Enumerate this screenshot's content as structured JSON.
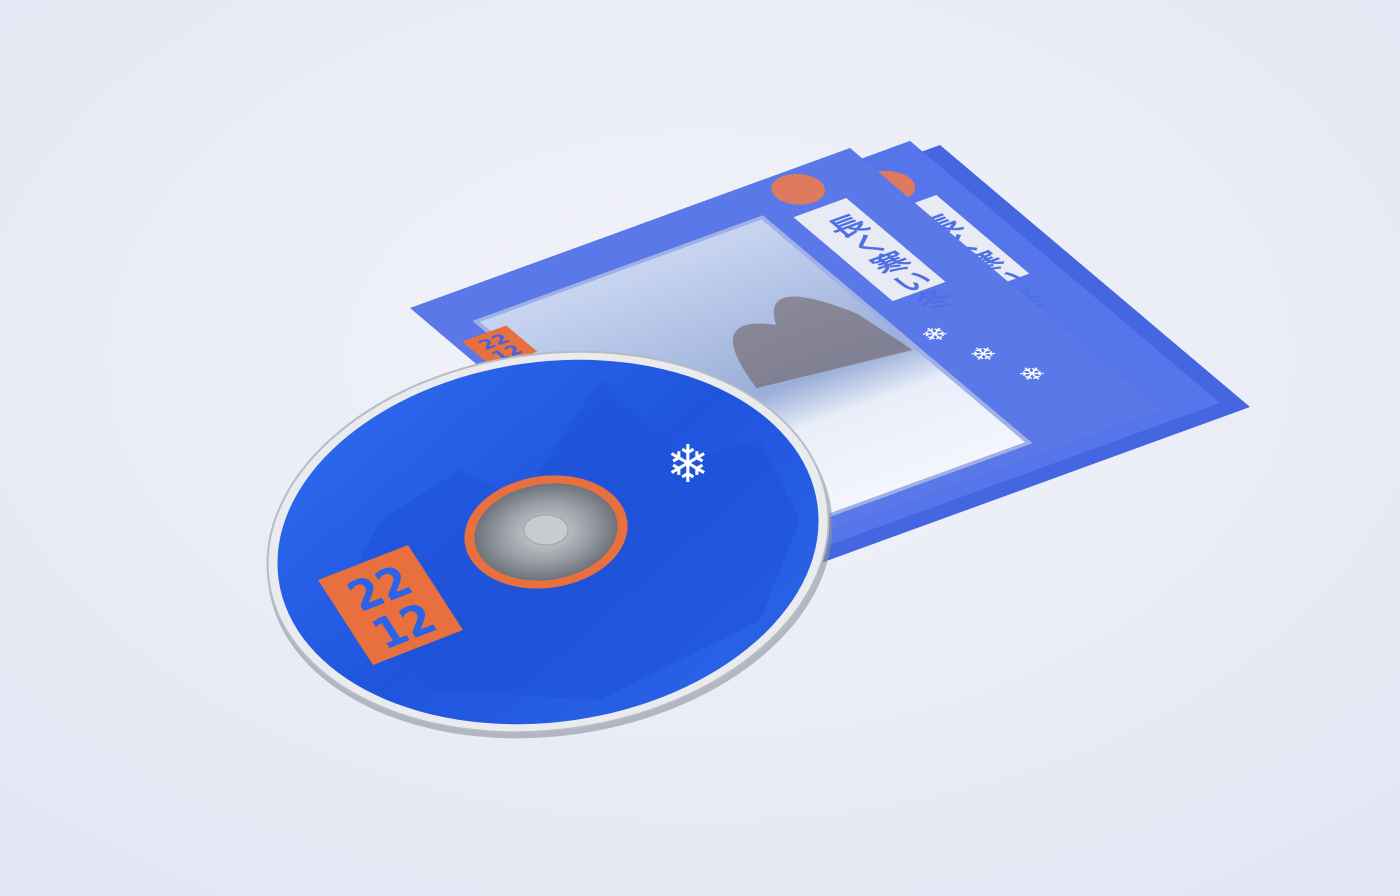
{
  "scene": {
    "background_color": "#eceef6",
    "sleeve_color": "#4f6fe6",
    "disc_color": "#2a62e8",
    "accent_orange": "#e8703f",
    "title_text": "長く寒い冬",
    "logo_text": [
      "22",
      "12"
    ],
    "snowflake_glyph": "❄"
  }
}
